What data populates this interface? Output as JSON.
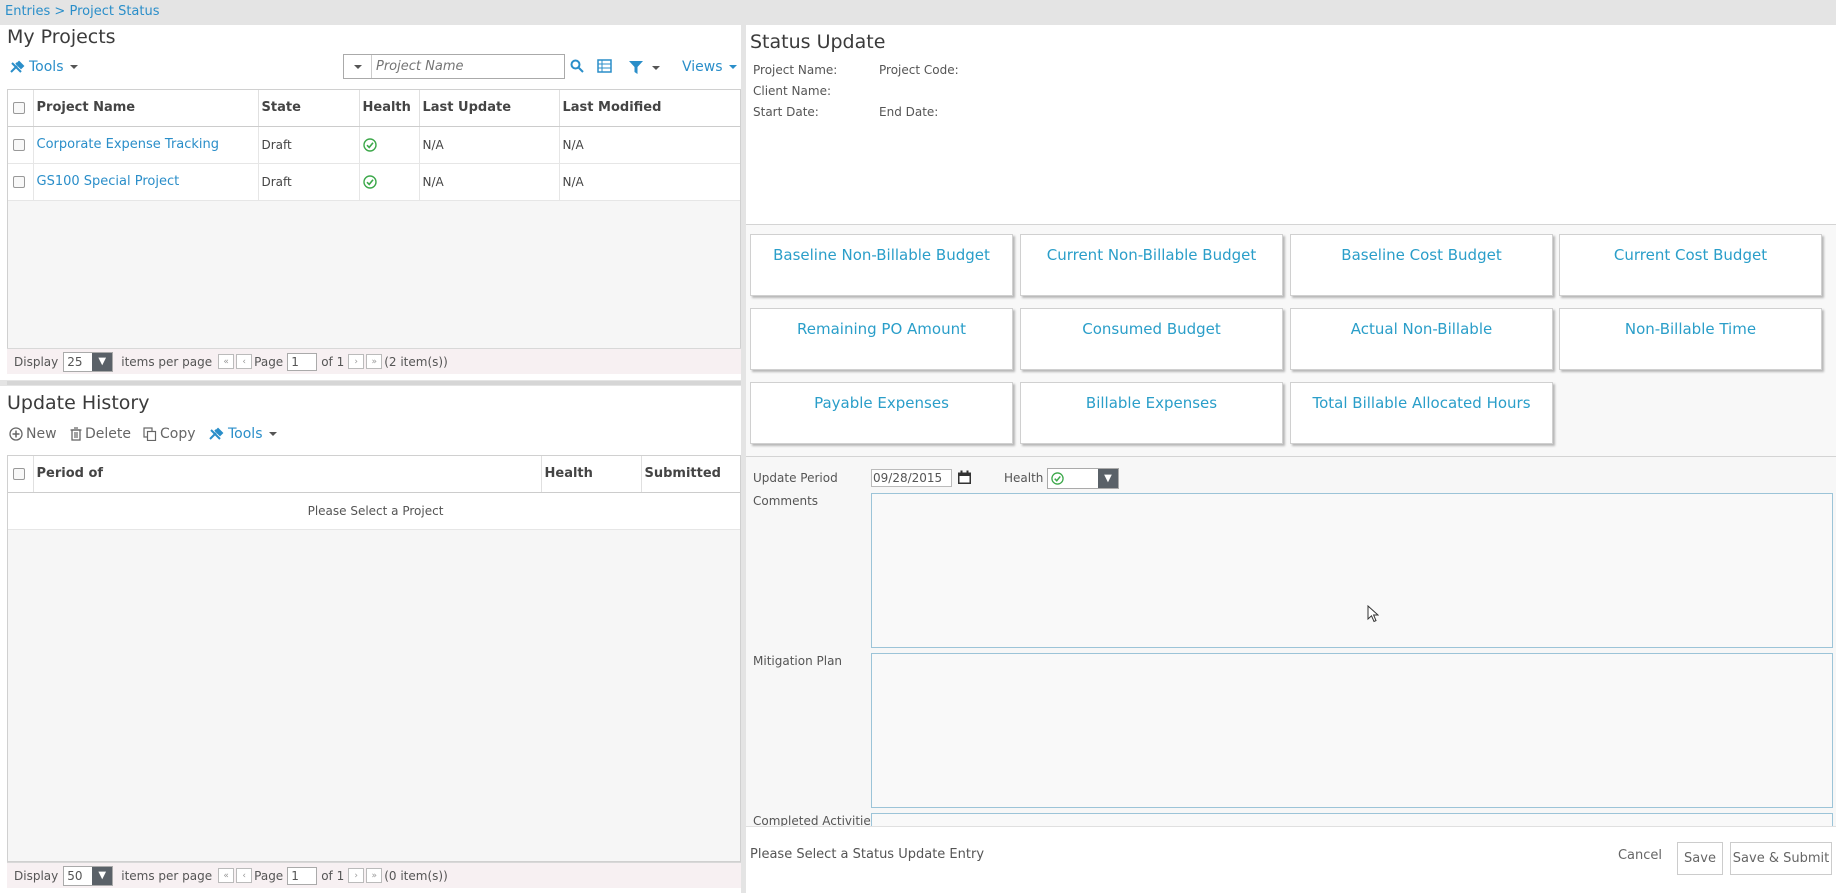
{
  "breadcrumb": {
    "entries": "Entries",
    "sep": ">",
    "current": "Project Status"
  },
  "my_projects": {
    "title": "My Projects",
    "tools_label": "Tools",
    "search_placeholder": "Project Name",
    "views_label": "Views",
    "columns": [
      "Project Name",
      "State",
      "Health",
      "Last Update",
      "Last Modified"
    ],
    "rows": [
      {
        "name": "Corporate Expense Tracking",
        "state": "Draft",
        "health": "check-circle-icon",
        "last_update": "N/A",
        "last_modified": "N/A"
      },
      {
        "name": "GS100 Special Project",
        "state": "Draft",
        "health": "check-circle-icon",
        "last_update": "N/A",
        "last_modified": "N/A"
      }
    ],
    "pager": {
      "display": "Display",
      "per_page": "25",
      "items_per_page": "items per page",
      "page": "Page",
      "page_num": "1",
      "of": "of 1",
      "count": "(2 item(s))"
    }
  },
  "update_history": {
    "title": "Update History",
    "new_label": "New",
    "delete_label": "Delete",
    "copy_label": "Copy",
    "tools_label": "Tools",
    "columns": [
      "Period of",
      "Health",
      "Submitted"
    ],
    "empty": "Please Select a Project",
    "pager": {
      "display": "Display",
      "per_page": "50",
      "items_per_page": "items per page",
      "page": "Page",
      "page_num": "1",
      "of": "of 1",
      "count": "(0 item(s))"
    }
  },
  "status_update": {
    "title": "Status Update",
    "project_name": "Project Name:",
    "project_code": "Project Code:",
    "client_name": "Client Name:",
    "start_date": "Start Date:",
    "end_date": "End Date:",
    "cards": [
      "Baseline Non-Billable Budget",
      "Current Non-Billable Budget",
      "Baseline Cost Budget",
      "Current Cost Budget",
      "Remaining PO Amount",
      "Consumed Budget",
      "Actual Non-Billable",
      "Non-Billable Time",
      "Payable Expenses",
      "Billable Expenses",
      "Total Billable Allocated Hours"
    ],
    "update_period_label": "Update Period",
    "update_period_value": "09/28/2015",
    "health_label": "Health",
    "comments_label": "Comments",
    "mitigation_label": "Mitigation Plan",
    "completed_label": "Completed Activities",
    "footer_msg": "Please Select a Status Update Entry",
    "cancel_label": "Cancel",
    "save_label": "Save",
    "save_submit_label": "Save & Submit"
  },
  "colors": {
    "link": "#2a8ec9",
    "card_text": "#2a9ec9",
    "health_green": "#3ca84a"
  }
}
